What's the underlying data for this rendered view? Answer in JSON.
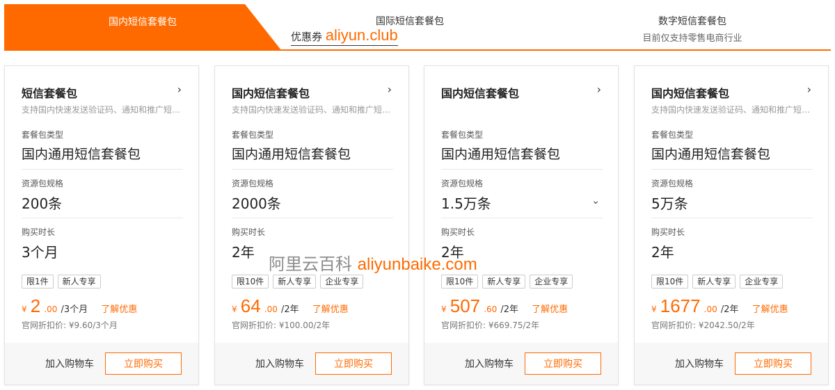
{
  "tabs": {
    "domestic": "国内短信套餐包",
    "international": "国际短信套餐包",
    "digital": "数字短信套餐包",
    "digital_sub": "目前仅支持零售电商行业"
  },
  "promo": {
    "prefix": "优惠券",
    "url": "aliyun.club"
  },
  "watermark": {
    "text": "阿里云百科",
    "url": "aliyunbaike.com"
  },
  "labels": {
    "package_type": "套餐包类型",
    "spec": "资源包规格",
    "duration": "购买时长",
    "official_prefix": "官网折扣价:",
    "learn_more": "了解优惠",
    "add_cart": "加入购物车",
    "buy_now": "立即购买",
    "arrow": "›",
    "dropdown": "⌄",
    "currency": "¥"
  },
  "accent_color": "#ff6a00",
  "cards": [
    {
      "title": "短信套餐包",
      "desc": "支持国内快速发送验证码、通知和推广短信...",
      "package_type": "国内通用短信套餐包",
      "spec": "200条",
      "duration": "3个月",
      "tags": [
        "限1件",
        "新人专享"
      ],
      "price_int": "2",
      "price_dec": ".00",
      "price_unit": "/3个月",
      "official": "¥9.60/3个月"
    },
    {
      "title": "国内短信套餐包",
      "desc": "支持国内快速发送验证码、通知和推广短信...",
      "package_type": "国内通用短信套餐包",
      "spec": "2000条",
      "duration": "2年",
      "tags": [
        "限10件",
        "新人专享",
        "企业专享"
      ],
      "price_int": "64",
      "price_dec": ".00",
      "price_unit": "/2年",
      "official": "¥100.00/2年"
    },
    {
      "title": "国内短信套餐包",
      "desc": "",
      "package_type": "国内通用短信套餐包",
      "spec": "1.5万条",
      "duration": "2年",
      "tags": [
        "限10件",
        "新人专享",
        "企业专享"
      ],
      "price_int": "507",
      "price_dec": ".60",
      "price_unit": "/2年",
      "official": "¥669.75/2年"
    },
    {
      "title": "国内短信套餐包",
      "desc": "支持国内快速发送验证码、通知和推广短信...",
      "package_type": "国内通用短信套餐包",
      "spec": "5万条",
      "duration": "2年",
      "tags": [
        "限10件",
        "新人专享",
        "企业专享"
      ],
      "price_int": "1677",
      "price_dec": ".00",
      "price_unit": "/2年",
      "official": "¥2042.50/2年"
    }
  ]
}
